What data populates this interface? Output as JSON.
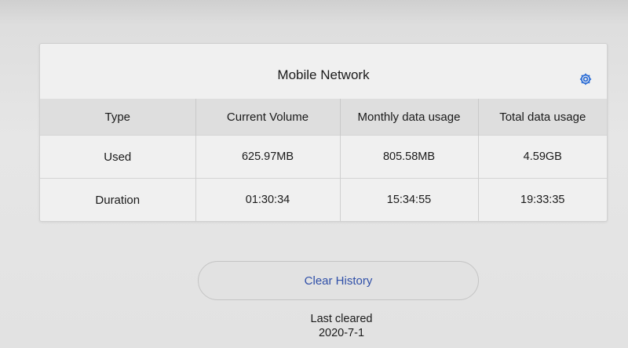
{
  "card": {
    "title": "Mobile Network",
    "settings_icon": "gear-icon",
    "accent_color": "#2f6fd6"
  },
  "table": {
    "headers": [
      "Type",
      "Current Volume",
      "Monthly data usage",
      "Total data usage"
    ],
    "rows": [
      [
        "Used",
        "625.97MB",
        "805.58MB",
        "4.59GB"
      ],
      [
        "Duration",
        "01:30:34",
        "15:34:55",
        "19:33:35"
      ]
    ]
  },
  "actions": {
    "clear_history_label": "Clear History"
  },
  "status": {
    "last_cleared_label": "Last cleared",
    "last_cleared_date": "2020-7-1"
  }
}
